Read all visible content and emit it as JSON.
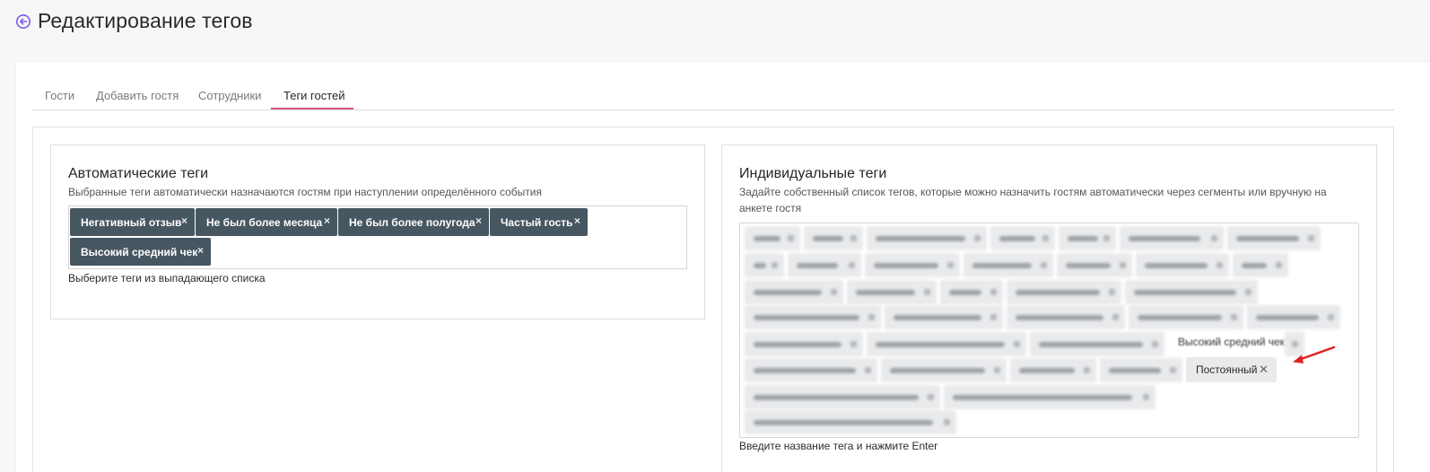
{
  "page": {
    "title": "Редактирование тегов",
    "back_icon": "arrow-circle-left-icon",
    "accent": "#7b5ce6"
  },
  "tabs": [
    {
      "label": "Гости",
      "active": false
    },
    {
      "label": "Добавить гостя",
      "active": false
    },
    {
      "label": "Сотрудники",
      "active": false
    },
    {
      "label": "Теги гостей",
      "active": true
    }
  ],
  "tab_accent": "#d9557a",
  "auto_tags": {
    "title": "Автоматические теги",
    "description": "Выбранные теги автоматически назначаются гостям при наступлении определённого события",
    "tags": [
      "Негативный отзыв",
      "Не был более месяца",
      "Не был более полугода",
      "Частый гость",
      "Высокий средний чек"
    ],
    "remove_glyph": "×",
    "hint": "Выберите теги из выпадающего списка",
    "chip_color": "#475761"
  },
  "individual_tags": {
    "title": "Индивидуальные теги",
    "description": "Задайте собственный список тегов, которые можно назначить гостям автоматически через сегменты или вручную на анкете гостя",
    "partially_visible_tag": "Высокий средний чек",
    "highlighted_tag": "Постоянный",
    "remove_glyph": "✕",
    "hint": "Введите название тега и нажмите Enter",
    "annotation_arrow_color": "#e02020"
  }
}
